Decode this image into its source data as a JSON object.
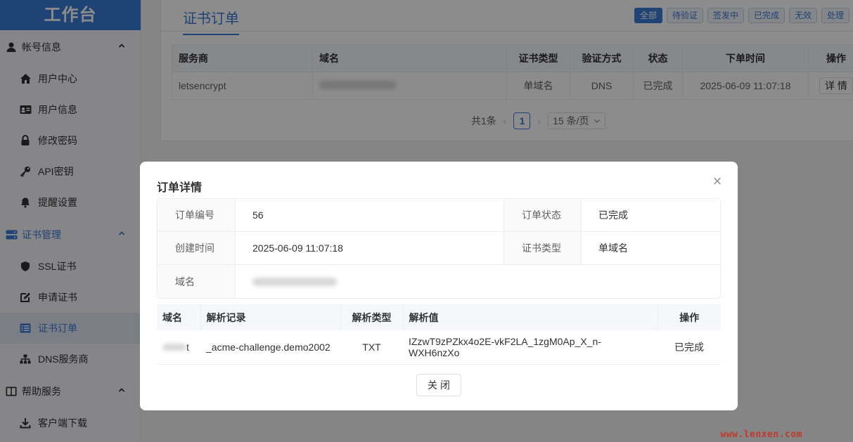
{
  "sidebar": {
    "brand": "工作台",
    "groups": [
      {
        "label": "帐号信息",
        "icon": "user-icon"
      },
      {
        "label": "证书管理",
        "icon": "certificate-manage-icon"
      },
      {
        "label": "帮助服务",
        "icon": "book-icon"
      }
    ],
    "items": [
      {
        "label": "用户中心",
        "icon": "home-icon"
      },
      {
        "label": "用户信息",
        "icon": "id-card-icon"
      },
      {
        "label": "修改密码",
        "icon": "lock-icon"
      },
      {
        "label": "API密钥",
        "icon": "key-icon"
      },
      {
        "label": "提醒设置",
        "icon": "bell-icon"
      },
      {
        "label": "SSL证书",
        "icon": "shield-icon"
      },
      {
        "label": "申请证书",
        "icon": "edit-icon"
      },
      {
        "label": "证书订单",
        "icon": "list-icon"
      },
      {
        "label": "DNS服务商",
        "icon": "sitemap-icon"
      },
      {
        "label": "客户端下载",
        "icon": "download-icon"
      }
    ]
  },
  "main": {
    "title": "证书订单",
    "filters": [
      "全部",
      "待验证",
      "签发中",
      "已完成",
      "无效",
      "处理"
    ],
    "table": {
      "headers": [
        "服务商",
        "域名",
        "证书类型",
        "验证方式",
        "状态",
        "下单时间",
        "操作"
      ],
      "rows": [
        {
          "provider": "letsencrypt",
          "type": "单域名",
          "method": "DNS",
          "status": "已完成",
          "time": "2025-06-09 11:07:18",
          "op": "详 情"
        }
      ]
    },
    "pager": {
      "total": "共1条",
      "page": "1",
      "size": "15 条/页"
    }
  },
  "dialog": {
    "title": "订单详情",
    "close_icon": "×",
    "info": {
      "order_no_label": "订单编号",
      "order_no": "56",
      "status_label": "订单状态",
      "status": "已完成",
      "created_label": "创建时间",
      "created": "2025-06-09 11:07:18",
      "cert_type_label": "证书类型",
      "cert_type": "单域名",
      "domain_label": "域名"
    },
    "records": {
      "headers": [
        "域名",
        "解析记录",
        "解析类型",
        "解析值",
        "操作"
      ],
      "rows": [
        {
          "domain_suffix": "t",
          "record": "_acme-challenge.demo2002",
          "type": "TXT",
          "value": "IZzwT9zPZkx4o2E-vkF2LA_1zgM0Ap_X_n-WXH6nzXo",
          "op": "已完成"
        }
      ]
    },
    "close_button": "关 闭"
  },
  "watermark": "www.lenxen.com",
  "colors": {
    "accent": "#3a7bd5"
  }
}
